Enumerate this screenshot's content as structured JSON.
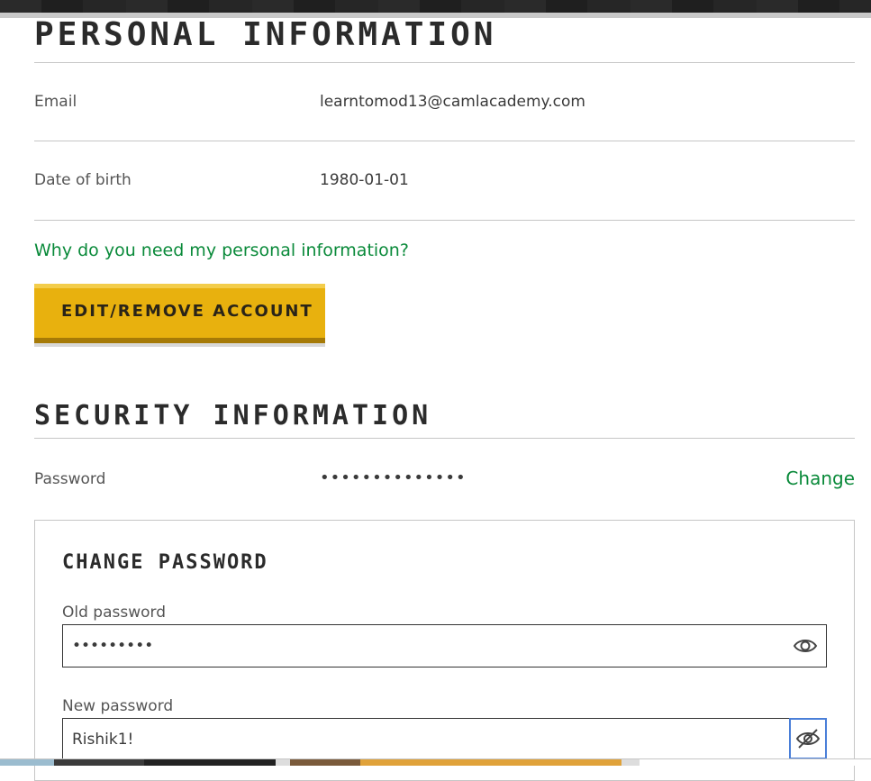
{
  "personal": {
    "title": "PERSONAL INFORMATION",
    "email_label": "Email",
    "email_value": "learntomod13@camlacademy.com",
    "dob_label": "Date of birth",
    "dob_value": "1980-01-01",
    "why_link": "Why do you need my personal information?",
    "edit_button": "EDIT/REMOVE ACCOUNT"
  },
  "security": {
    "title": "SECURITY INFORMATION",
    "password_label": "Password",
    "password_value": "••••••••••••••",
    "change_link": "Change"
  },
  "change_password": {
    "title": "CHANGE PASSWORD",
    "old_label": "Old password",
    "old_value": "•••••••••",
    "new_label": "New password",
    "new_value": "Rishik1!"
  },
  "icons": {
    "show": "eye-icon",
    "hide": "eye-off-icon"
  },
  "colors": {
    "link_green": "#0a8a3a",
    "button_yellow": "#e8b10e",
    "focus_blue": "#4a7fd8"
  }
}
